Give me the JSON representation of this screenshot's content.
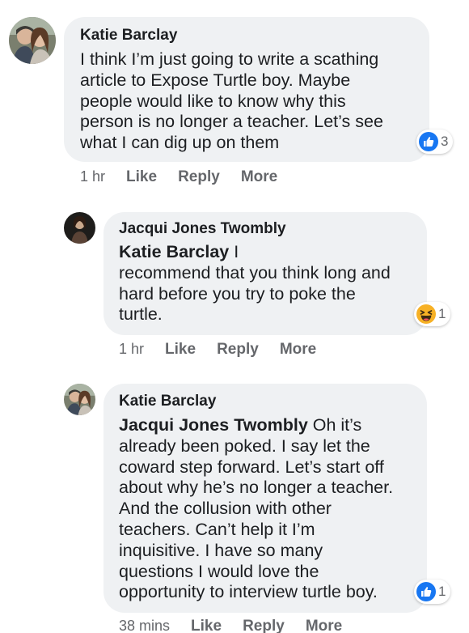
{
  "comments": [
    {
      "author": "Katie Barclay",
      "mention": "",
      "text_lines": [
        "I think I’m just going to write a scathing",
        "article to Expose Turtle boy. Maybe",
        "people would like to know why this",
        "person is no longer a teacher. Let’s see",
        "what I can dig up on them"
      ],
      "reaction": {
        "icon": "like-icon",
        "count": "3"
      },
      "time": "1 hr",
      "actions": {
        "like": "Like",
        "reply": "Reply",
        "more": "More"
      }
    },
    {
      "author": "Jacqui Jones Twombly",
      "mention": "Katie Barclay",
      "first_line_rest": " I",
      "text_lines": [
        "recommend that you think long and",
        "hard before you try to poke the",
        "turtle."
      ],
      "reaction": {
        "icon": "haha-icon",
        "count": "1"
      },
      "time": "1 hr",
      "actions": {
        "like": "Like",
        "reply": "Reply",
        "more": "More"
      }
    },
    {
      "author": "Katie Barclay",
      "mention": "Jacqui Jones Twombly",
      "first_line_rest": " Oh it’s",
      "text_lines": [
        "already been poked. I say let the",
        "coward step forward. Let’s start off",
        "about why he’s no longer a teacher.",
        "And the collusion with other",
        "teachers. Can’t help it I’m",
        "inquisitive. I have so many",
        "questions I would love the",
        "opportunity to interview turtle boy."
      ],
      "reaction": {
        "icon": "like-icon",
        "count": "1"
      },
      "time": "38 mins",
      "actions": {
        "like": "Like",
        "reply": "Reply",
        "more": "More"
      }
    }
  ],
  "colors": {
    "bubble": "#eff1f3",
    "meta_text": "#65676b",
    "like_blue": "#1877f2",
    "haha_yellow": "#f7b125"
  }
}
